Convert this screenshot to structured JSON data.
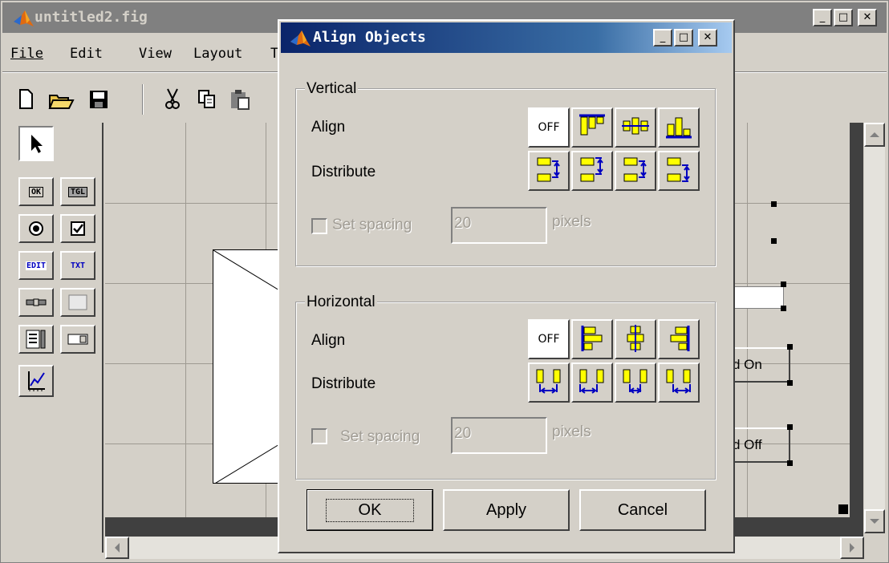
{
  "main_window": {
    "title": "untitled2.fig",
    "menu": [
      "File",
      "Edit",
      "View",
      "Layout",
      "T"
    ],
    "canvas_buttons": [
      "d On",
      "d Off"
    ]
  },
  "palette_tools": [
    "select-arrow",
    "push-button",
    "toggle-button",
    "radio-button",
    "checkbox",
    "edit-text",
    "static-text",
    "slider",
    "frame",
    "listbox",
    "popup-menu",
    "axes"
  ],
  "palette_labels": {
    "ok": "OK",
    "tgl": "TGL",
    "edit": "EDIT",
    "txt": "TXT"
  },
  "dialog": {
    "title": "Align Objects",
    "vertical": {
      "group_label": "Vertical",
      "align_label": "Align",
      "distribute_label": "Distribute",
      "off_label": "OFF",
      "spacing_label": "Set spacing",
      "spacing_value": "20",
      "units": "pixels"
    },
    "horizontal": {
      "group_label": "Horizontal",
      "align_label": "Align",
      "distribute_label": "Distribute",
      "off_label": "OFF",
      "spacing_label": "Set spacing",
      "spacing_value": "20",
      "units": "pixels"
    },
    "buttons": {
      "ok": "OK",
      "apply": "Apply",
      "cancel": "Cancel"
    }
  },
  "colors": {
    "titlebar_active": "#0a246a",
    "titlebar_inactive": "#808080",
    "face": "#d4d0c8",
    "icon_yellow": "#ffff00",
    "icon_blue": "#0000c0"
  }
}
